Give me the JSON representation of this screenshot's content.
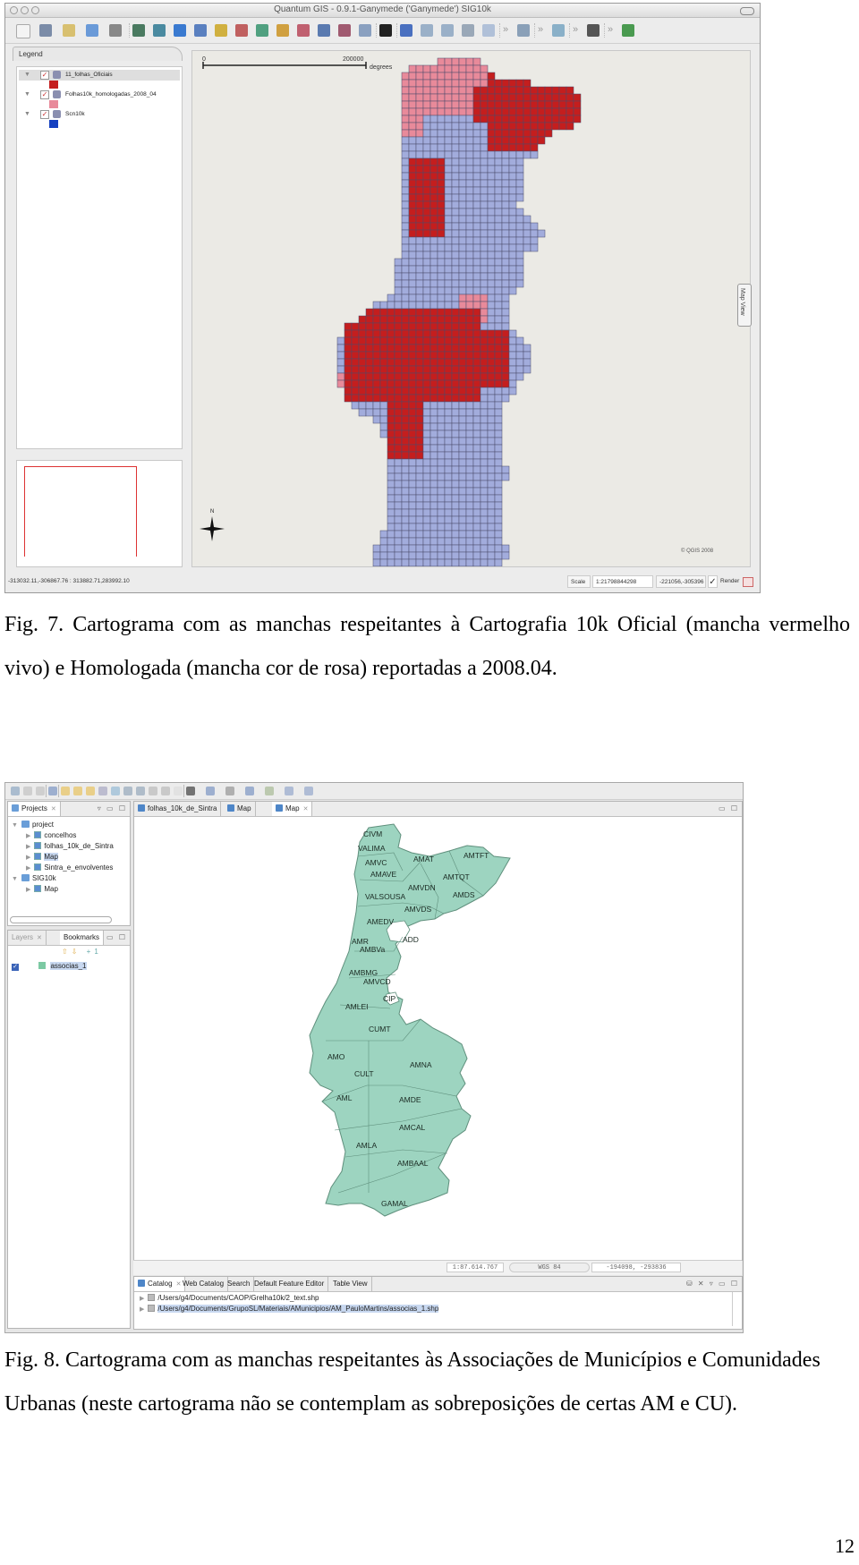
{
  "figure7": {
    "window": {
      "title": "Quantum GIS - 0.9.1-Ganymede ('Ganymede') SIG10k",
      "toolbar_icons": [
        "new-project-icon",
        "save-icon",
        "save-as-icon",
        "open-icon",
        "print-icon",
        "add-vector-icon",
        "add-raster-icon",
        "add-postgis-icon",
        "add-wms-icon",
        "layer-icon",
        "remove-layer-icon",
        "overview-icon",
        "show-all-icon",
        "hide-all-icon",
        "in-overview-icon",
        "remove-overview-icon",
        "attach-icon",
        "whats-this-icon",
        "capture-point-icon",
        "capture-line-icon",
        "capture-polygon-icon",
        "delete-icon",
        "move-icon",
        "pan-icon",
        "identify-icon",
        "copyright-icon",
        "plugin-icon"
      ],
      "more_glyph": "»"
    },
    "legend": {
      "tab_label": "Legend",
      "layers": [
        {
          "name": "11_folhas_Oficiais",
          "checked": true,
          "swatch_color": "#c41e1e"
        },
        {
          "name": "Folhas10k_homologadas_2008_04",
          "checked": true,
          "swatch_color": "#e88a9a"
        },
        {
          "name": "Scn10k",
          "checked": true,
          "swatch_color": "#1540c0"
        }
      ]
    },
    "map": {
      "scalebar_start": "0",
      "scalebar_end": "200000",
      "scalebar_unit": "degrees",
      "north_label": "N",
      "copyright": "© QGIS 2008",
      "map_view_tab": "Map View",
      "colors": {
        "official": "#c41e1e",
        "homologated": "#e88a9a",
        "base": "#a2acdc",
        "grid": "#4a4a6a",
        "canvas": "#ebeae5"
      }
    },
    "statusbar": {
      "extents": "-313032.11,-306867.76 : 313882.71,283992.10",
      "scale_label": "Scale",
      "scale_value": "1:21798844298",
      "coords": "-221056,-305396",
      "render_label": "Render",
      "render_checked": true
    }
  },
  "caption7": "Fig. 7. Cartograma com as manchas respeitantes à Cartografia 10k Oficial (mancha vermelho vivo) e Homologada (mancha cor de rosa) reportadas a 2008.04.",
  "figure8": {
    "projects_panel": {
      "tab_label": "Projects",
      "tree": [
        {
          "label": "project",
          "level": 0,
          "type": "project",
          "expanded": true
        },
        {
          "label": "concelhos",
          "level": 1,
          "type": "map"
        },
        {
          "label": "folhas_10k_de_Sintra",
          "level": 1,
          "type": "map"
        },
        {
          "label": "Map",
          "level": 1,
          "type": "map",
          "selected": true
        },
        {
          "label": "Sintra_e_envolventes",
          "level": 1,
          "type": "map"
        },
        {
          "label": "SIG10k",
          "level": 0,
          "type": "project",
          "expanded": true
        },
        {
          "label": "Map",
          "level": 1,
          "type": "map"
        }
      ]
    },
    "layers_panel": {
      "tabs": [
        "Layers",
        "Bookmarks"
      ],
      "layers": [
        {
          "name": "associas_1",
          "checked": true
        }
      ]
    },
    "editor_tabs": [
      {
        "label": "folhas_10k_de_Sintra",
        "active": false
      },
      {
        "label": "Map",
        "active": false
      },
      {
        "label": "Map",
        "active": true
      }
    ],
    "map": {
      "fill_color": "#9dd4c0",
      "border_color": "#5f8f7c",
      "regions": [
        "CIVM",
        "VALIMA",
        "AMVC",
        "AMAVE",
        "AMAT",
        "AMTFT",
        "AMTQT",
        "AMVDN",
        "AMDS",
        "VALSOUSA",
        "AMVDS",
        "AMEDV",
        "AMR",
        "AMBVa",
        "ADD",
        "AMBMG",
        "AMVCD",
        "CIP",
        "AMLEI",
        "CUMT",
        "AMO",
        "CULT",
        "AMNA",
        "AML",
        "AMDE",
        "AMCAL",
        "AMLA",
        "AMBAAL",
        "GAMAL"
      ]
    },
    "coord_bar": {
      "scale": "1:87.614.767",
      "crs": "WGS 84",
      "coords": "-194098, -293836"
    },
    "bottom_panel": {
      "tabs": [
        "Catalog",
        "Web Catalog",
        "Search",
        "Default Feature Editor",
        "Table View"
      ],
      "entries": [
        {
          "path": "/Users/g4/Documents/CAOP/Grelha10k/2_text.shp",
          "selected": false
        },
        {
          "path": "/Users/g4/Documents/GrupoSL/Materiais/AMunicipios/AM_PauloMartins/associas_1.shp",
          "selected": true
        }
      ]
    }
  },
  "caption8": "Fig. 8. Cartograma com as manchas respeitantes às Associações de Municípios e Comunidades Urbanas (neste cartograma não se contemplam as sobreposições de certas AM e CU).",
  "page_number": "12"
}
